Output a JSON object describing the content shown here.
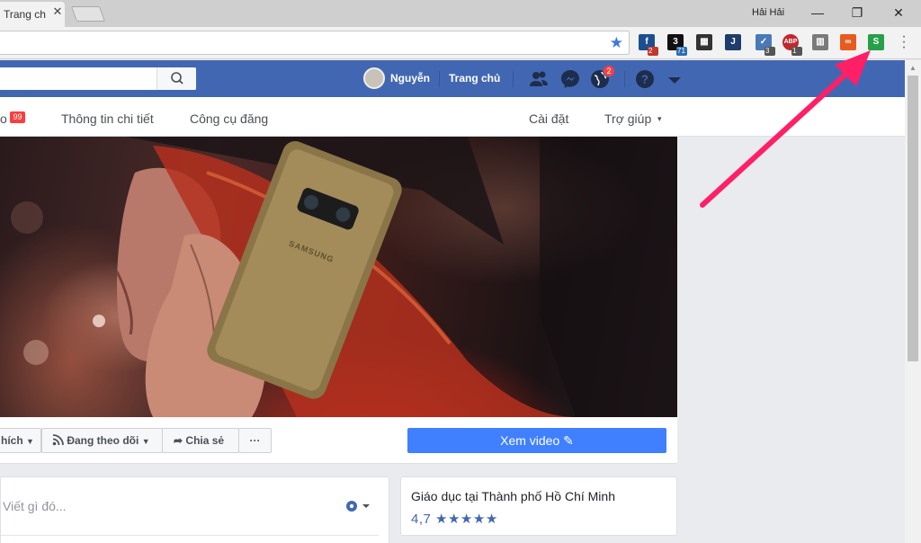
{
  "browser": {
    "tab_title": "Trang ch",
    "tab_close": "✕",
    "user_profile": "Hải Hải",
    "window_controls": {
      "minimize": "—",
      "restore": "❐",
      "close": "✕"
    },
    "extensions": [
      {
        "name": "facebook-ext-icon",
        "letter": "f",
        "color": "#1c4f8f",
        "badge": "2",
        "badge_color": "#c0392b"
      },
      {
        "name": "steemit-ext-icon",
        "letter": "3",
        "color": "#111111",
        "badge": "71",
        "badge_color": "#2e6db4"
      },
      {
        "name": "film-ext-icon",
        "letter": "▦",
        "color": "#333333",
        "badge": "",
        "badge_color": ""
      },
      {
        "name": "jword-ext-icon",
        "letter": "J",
        "color": "#1f3d6b",
        "badge": "",
        "badge_color": ""
      },
      {
        "name": "shield-ext-icon",
        "letter": "✓",
        "color": "#4b79b8",
        "badge": "3",
        "badge_color": "#555555"
      },
      {
        "name": "abp-ext-icon",
        "letter": "ABP",
        "color": "#c0282d",
        "badge": "1",
        "badge_color": "#555555"
      },
      {
        "name": "trello-ext-icon",
        "letter": "▥",
        "color": "#7a7a7a",
        "badge": "",
        "badge_color": ""
      },
      {
        "name": "infinity-ext-icon",
        "letter": "∞",
        "color": "#e85b1e",
        "badge": "",
        "badge_color": ""
      },
      {
        "name": "s-ext-icon",
        "letter": "S",
        "color": "#27a04a",
        "badge": "",
        "badge_color": ""
      }
    ]
  },
  "fb_header": {
    "user_name": "Nguyễn",
    "home_label": "Trang chủ",
    "notifications_count": "2"
  },
  "page_nav": {
    "partial_item_suffix": "o",
    "partial_item_badge": "99",
    "items": [
      "Thông tin chi tiết",
      "Công cụ đăng"
    ],
    "settings": "Cài đặt",
    "help": "Trợ giúp",
    "help_caret": "▾"
  },
  "actions": {
    "like": "hích",
    "follow": "Đang theo dõi",
    "share": "Chia sẻ",
    "more": "···",
    "watch_video": "Xem video"
  },
  "composer": {
    "placeholder": "Viết gì đó..."
  },
  "about": {
    "category": "Giáo dục tại Thành phố Hồ Chí Minh",
    "rating": "4,7",
    "stars": "★★★★★"
  },
  "colors": {
    "fb_blue": "#4267b2",
    "button_blue": "#4080ff",
    "arrow_pink": "#ff1f66"
  }
}
